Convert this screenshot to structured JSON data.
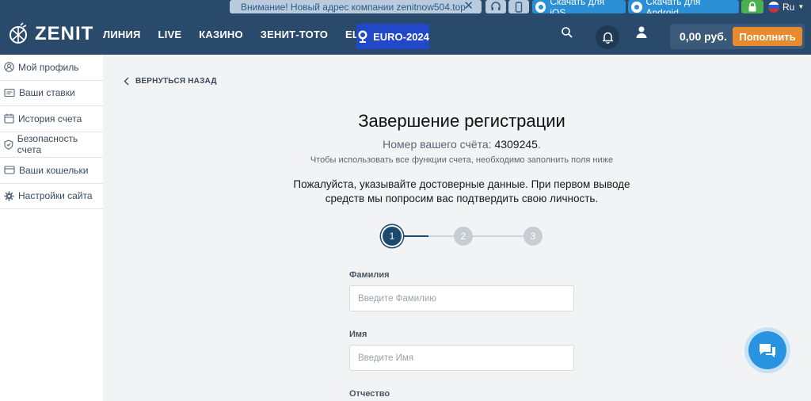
{
  "topbar": {
    "notice": "Внимание! Новый адрес компании zenitnow504.top",
    "ios_label": "Скачать для iOS",
    "android_label": "Скачать для Android",
    "language": "Ru"
  },
  "header": {
    "logo": "ZENIT",
    "nav": [
      "ЛИНИЯ",
      "LIVE",
      "КАЗИНО",
      "ЗЕНИТ-ТОТО",
      "ЕЩЕ"
    ],
    "euro": "EURO-2024",
    "balance": "0,00 руб.",
    "deposit_label": "Пополнить"
  },
  "sidebar": {
    "items": [
      {
        "label": "Мой профиль",
        "icon": "user-circle-icon"
      },
      {
        "label": "Ваши ставки",
        "icon": "ticket-icon"
      },
      {
        "label": "История счета",
        "icon": "calendar-icon"
      },
      {
        "label": "Безопасность счета",
        "icon": "shield-icon"
      },
      {
        "label": "Ваши кошельки",
        "icon": "wallet-icon"
      },
      {
        "label": "Настройки сайта",
        "icon": "gear-icon"
      }
    ]
  },
  "main": {
    "back_label": "ВЕРНУТЬСЯ НАЗАД",
    "title": "Завершение регистрации",
    "account_label": "Номер вашего счёта:",
    "account_number": "4309245",
    "account_dot": ".",
    "hint": "Чтобы использовать все функции счета, необходимо заполнить поля ниже",
    "warning": "Пожалуйста, указывайте достоверные данные. При первом выводе средств мы попросим вас подтвердить свою личность.",
    "steps": [
      "1",
      "2",
      "3"
    ],
    "current_step": 1,
    "fields": {
      "surname_label": "Фамилия",
      "surname_placeholder": "Введите Фамилию",
      "name_label": "Имя",
      "name_placeholder": "Введите Имя",
      "patronymic_label": "Отчество"
    }
  },
  "colors": {
    "header": "#2a4a6b",
    "accent": "#e88a2e",
    "active_step": "#1c4a6e",
    "inactive_step": "#c7cdd3",
    "chat": "#2893e0"
  }
}
